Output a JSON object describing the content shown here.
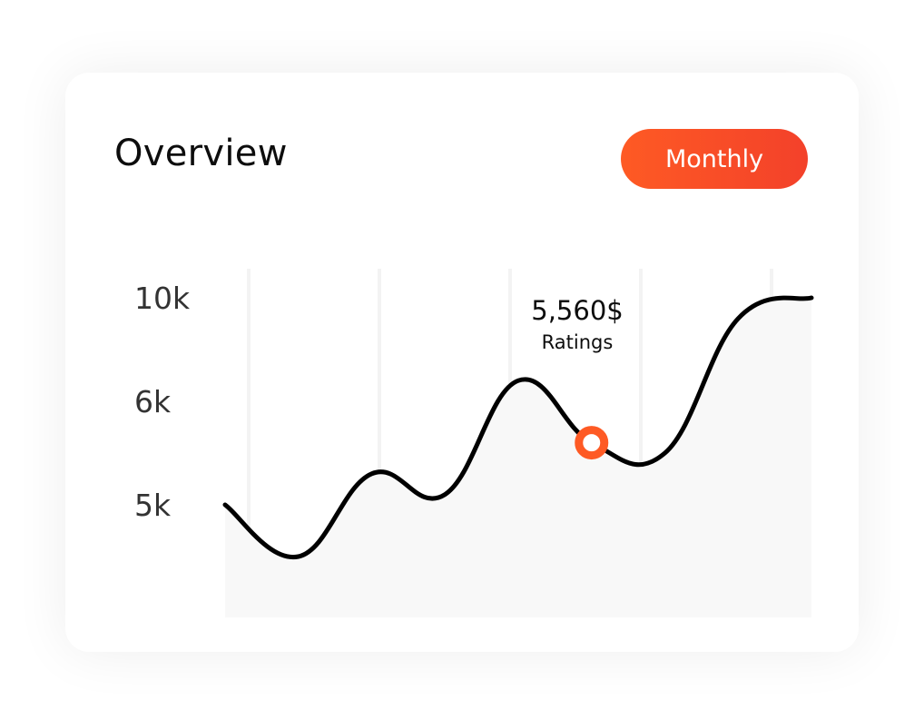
{
  "header": {
    "title": "Overview",
    "period_button_label": "Monthly"
  },
  "colors": {
    "accent": "#FE5A24",
    "line": "#000000",
    "area_fill": "#F8F8F8",
    "gridline": "#F3F3F3"
  },
  "chart_data": {
    "type": "line",
    "y_tick_labels": [
      "10k",
      "6k",
      "5k"
    ],
    "series": [
      {
        "values": [
          5.0,
          4.5,
          5.3,
          5.1,
          6.2,
          5.6,
          5.5,
          6.8,
          7.0
        ]
      }
    ],
    "highlight": {
      "index": 5,
      "value_label": "5,560$",
      "sub_label": "Ratings"
    },
    "vertical_gridlines": 5,
    "grid": true,
    "smooth": true
  }
}
